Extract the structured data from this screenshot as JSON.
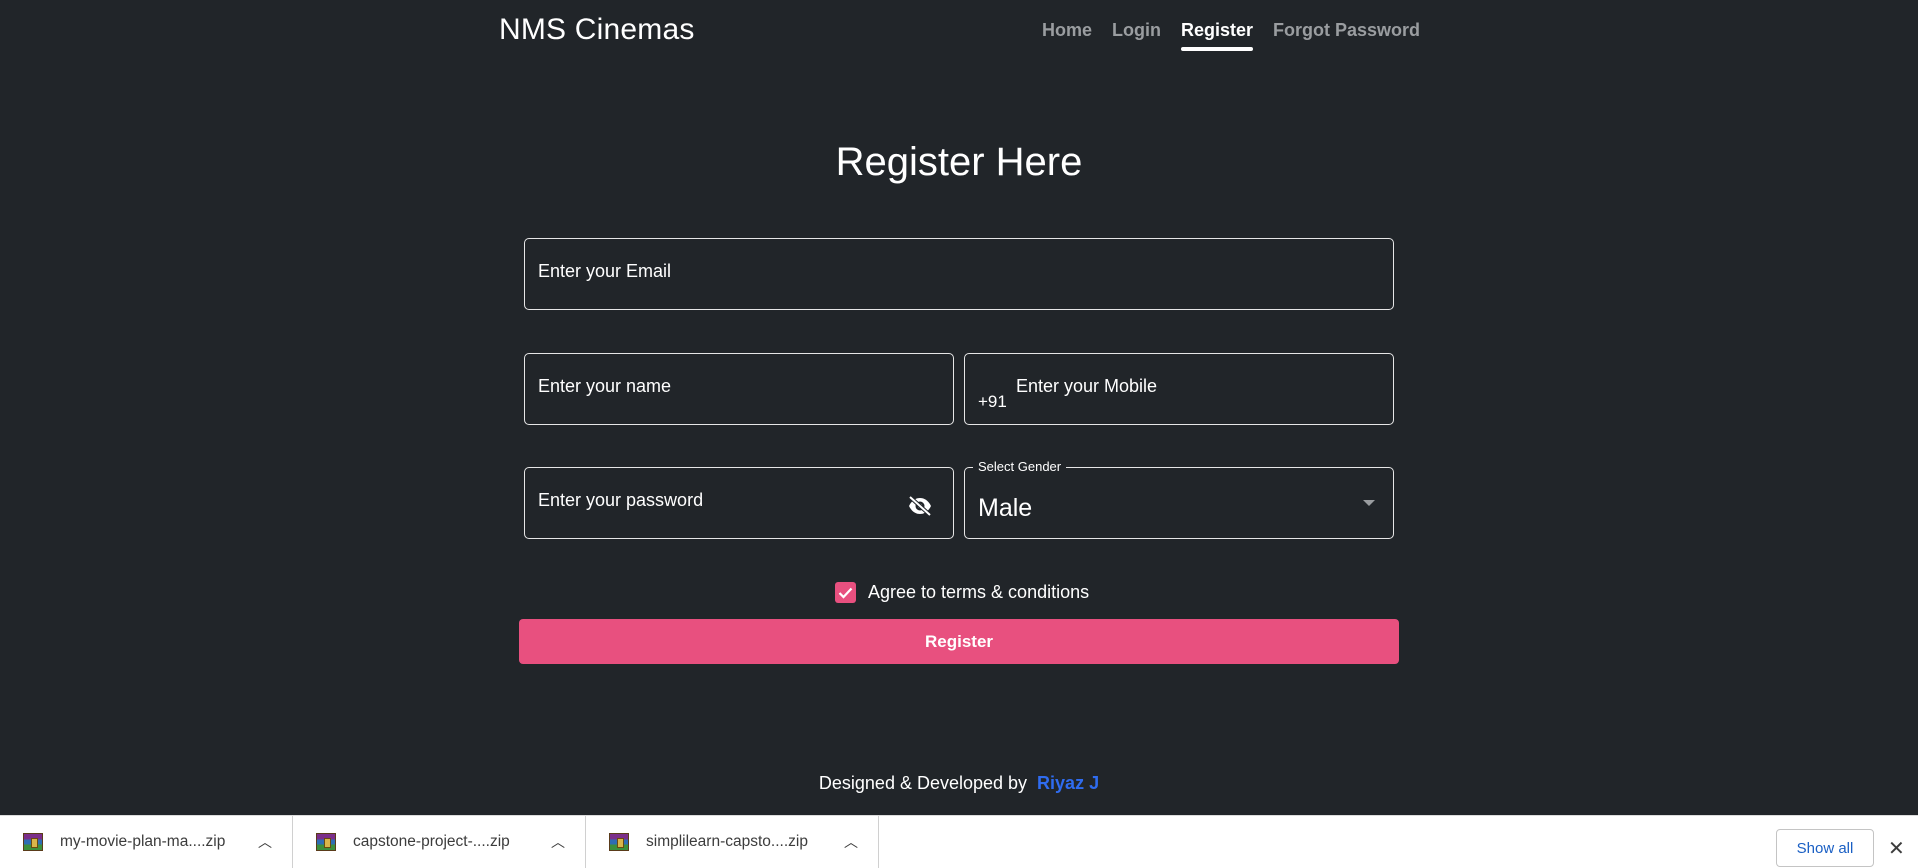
{
  "navbar": {
    "brand": "NMS Cinemas",
    "links": [
      {
        "label": "Home",
        "active": false
      },
      {
        "label": "Login",
        "active": false
      },
      {
        "label": "Register",
        "active": true
      },
      {
        "label": "Forgot Password",
        "active": false
      }
    ]
  },
  "form": {
    "title": "Register Here",
    "email_placeholder": "Enter your Email",
    "name_placeholder": "Enter your name",
    "mobile_prefix": "+91",
    "mobile_placeholder": "Enter your Mobile",
    "password_placeholder": "Enter your password",
    "password_toggle_icon": "eye-off-icon",
    "gender_label": "Select Gender",
    "gender_value": "Male",
    "agree_label": "Agree to terms & conditions",
    "agree_checked": true,
    "submit_label": "Register"
  },
  "footer": {
    "text": "Designed & Developed by",
    "author": "Riyaz J"
  },
  "download_bar": {
    "items": [
      {
        "name": "my-movie-plan-ma....zip",
        "icon": "archive-icon"
      },
      {
        "name": "capstone-project-....zip",
        "icon": "archive-icon"
      },
      {
        "name": "simplilearn-capsto....zip",
        "icon": "archive-icon"
      }
    ],
    "show_all_label": "Show all",
    "close_label": "✕"
  },
  "colors": {
    "background": "#212529",
    "accent": "#e8507f",
    "author_link": "#2f6cf0"
  }
}
